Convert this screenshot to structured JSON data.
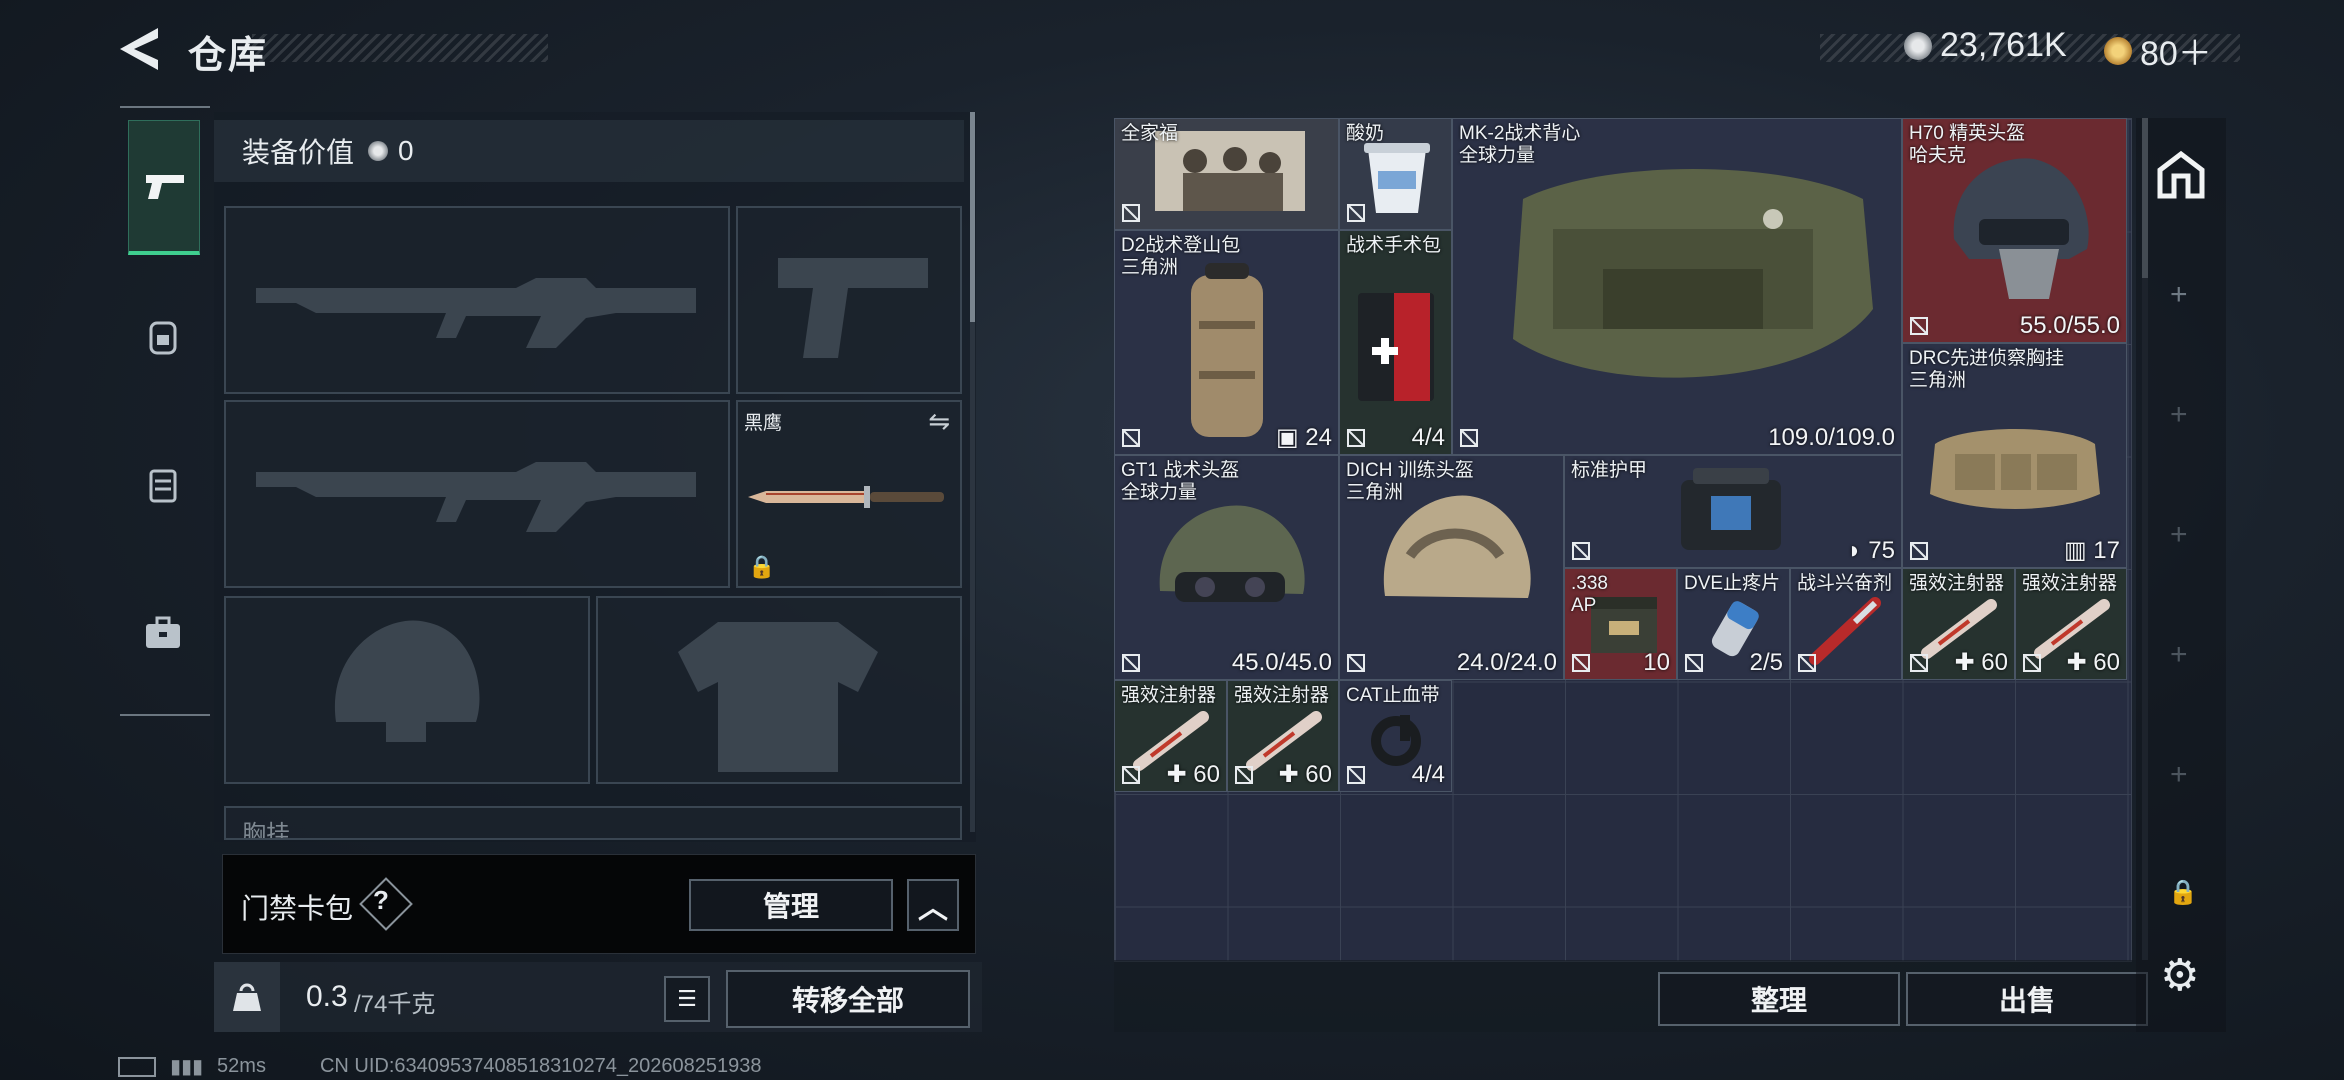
{
  "header": {
    "title": "仓库",
    "currency_amount": "23,761K",
    "tickets": "80＋"
  },
  "tabs": [
    {
      "icon": "pistol-icon"
    },
    {
      "icon": "backpack-icon"
    },
    {
      "icon": "vest-icon"
    },
    {
      "icon": "briefcase-icon"
    }
  ],
  "loadout": {
    "equip_value_label": "装备价值",
    "equip_value": "0",
    "melee_name": "黑鹰",
    "next_slot_label": "胸挂",
    "keycard_label": "门禁卡包",
    "keycard_help": "?",
    "manage_label": "管理",
    "weight_current": "0.3",
    "weight_max": "/74千克",
    "transfer_all_label": "转移全部"
  },
  "stash": {
    "items": [
      {
        "name": "全家福",
        "value": ""
      },
      {
        "name": "酸奶",
        "value": ""
      },
      {
        "name": "MK-2战术背心",
        "sub": "全球力量",
        "value": "109.0/109.0"
      },
      {
        "name": "H70 精英头盔",
        "sub": "哈夫克",
        "value": "55.0/55.0"
      },
      {
        "name": "D2战术登山包",
        "sub": "三角洲",
        "value": "24"
      },
      {
        "name": "战术手术包",
        "value": "4/4"
      },
      {
        "name": "DRC先进侦察胸挂",
        "sub": "三角洲",
        "value": "17"
      },
      {
        "name": "GT1 战术头盔",
        "sub": "全球力量",
        "value": "45.0/45.0"
      },
      {
        "name": "DICH 训练头盔",
        "sub": "三角洲",
        "value": "24.0/24.0"
      },
      {
        "name": "标准护甲",
        "value": "75"
      },
      {
        "name": ".338",
        "sub": "AP",
        "value": "10"
      },
      {
        "name": "DVE止疼片",
        "value": "2/5"
      },
      {
        "name": "战斗兴奋剂",
        "value": ""
      },
      {
        "name": "强效注射器",
        "value": "60"
      },
      {
        "name": "强效注射器",
        "value": "60"
      },
      {
        "name": "强效注射器",
        "value": "60"
      },
      {
        "name": "强效注射器",
        "value": "60"
      },
      {
        "name": "CAT止血带",
        "value": "4/4"
      }
    ],
    "sort_label": "整理",
    "sell_label": "出售"
  },
  "status": {
    "ping": "52ms",
    "uid": "CN UID:6340953740851831027​4_202608251938"
  }
}
